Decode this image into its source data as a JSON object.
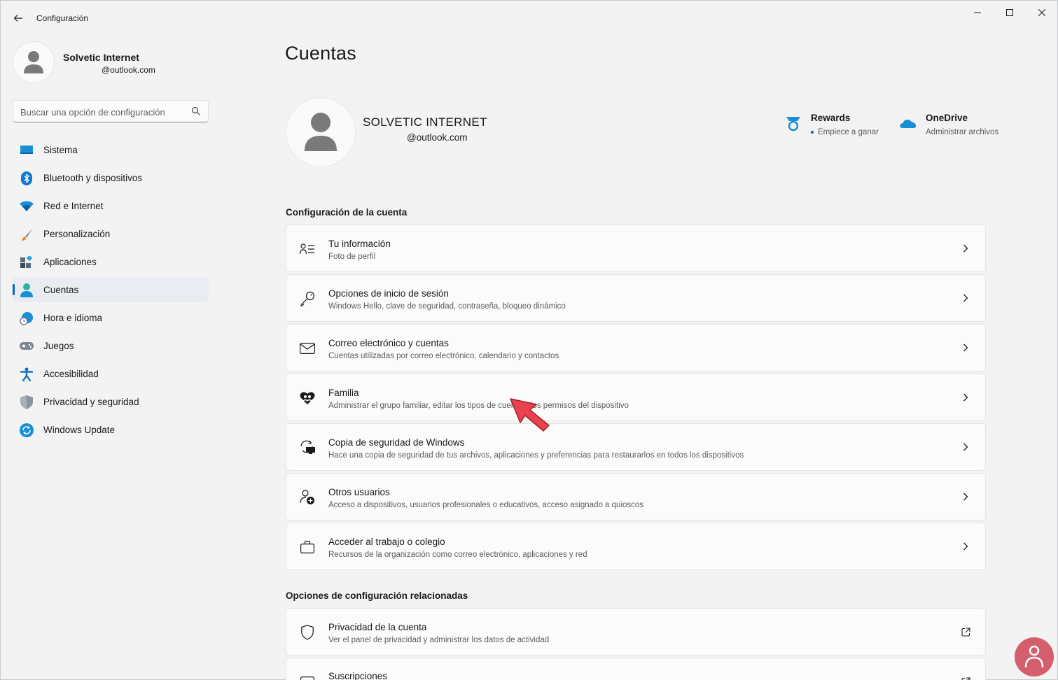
{
  "window": {
    "title": "Configuración"
  },
  "profile": {
    "name": "Solvetic Internet",
    "email": "@outlook.com"
  },
  "search": {
    "placeholder": "Buscar una opción de configuración"
  },
  "sidebar": {
    "items": [
      {
        "label": "Sistema",
        "icon": "monitor-icon",
        "active": false
      },
      {
        "label": "Bluetooth y dispositivos",
        "icon": "bluetooth-icon",
        "active": false
      },
      {
        "label": "Red e Internet",
        "icon": "wifi-icon",
        "active": false
      },
      {
        "label": "Personalización",
        "icon": "brush-icon",
        "active": false
      },
      {
        "label": "Aplicaciones",
        "icon": "apps-icon",
        "active": false
      },
      {
        "label": "Cuentas",
        "icon": "person-icon",
        "active": true
      },
      {
        "label": "Hora e idioma",
        "icon": "clock-globe-icon",
        "active": false
      },
      {
        "label": "Juegos",
        "icon": "gamepad-icon",
        "active": false
      },
      {
        "label": "Accesibilidad",
        "icon": "accessibility-icon",
        "active": false
      },
      {
        "label": "Privacidad y seguridad",
        "icon": "shield-icon",
        "active": false
      },
      {
        "label": "Windows Update",
        "icon": "update-icon",
        "active": false
      }
    ]
  },
  "main": {
    "title": "Cuentas",
    "account": {
      "name": "SOLVETIC INTERNET",
      "email": "@outlook.com"
    },
    "services": [
      {
        "title": "Rewards",
        "subtitle": "Empiece a ganar",
        "icon": "rewards-medal-icon"
      },
      {
        "title": "OneDrive",
        "subtitle": "Administrar archivos",
        "icon": "onedrive-cloud-icon"
      }
    ],
    "account_section_title": "Configuración de la cuenta",
    "account_cards": [
      {
        "title": "Tu información",
        "subtitle": "Foto de perfil",
        "icon": "person-card-icon"
      },
      {
        "title": "Opciones de inicio de sesión",
        "subtitle": "Windows Hello, clave de seguridad, contraseña, bloqueo dinámico",
        "icon": "key-icon"
      },
      {
        "title": "Correo electrónico y cuentas",
        "subtitle": "Cuentas utilizadas por correo electrónico, calendario y contactos",
        "icon": "mail-icon"
      },
      {
        "title": "Familia",
        "subtitle": "Administrar el grupo familiar, editar los tipos de cuenta y los permisos del dispositivo",
        "icon": "family-heart-icon"
      },
      {
        "title": "Copia de seguridad de Windows",
        "subtitle": "Hace una copia de seguridad de tus archivos, aplicaciones y preferencias para restaurarlos en todos los dispositivos",
        "icon": "backup-sync-icon"
      },
      {
        "title": "Otros usuarios",
        "subtitle": "Acceso a dispositivos, usuarios profesionales o educativos, acceso asignado a quioscos",
        "icon": "person-add-icon"
      },
      {
        "title": "Acceder al trabajo o colegio",
        "subtitle": "Recursos de la organización como correo electrónico, aplicaciones y red",
        "icon": "briefcase-icon"
      }
    ],
    "related_section_title": "Opciones de configuración relacionadas",
    "related_cards": [
      {
        "title": "Privacidad de la cuenta",
        "subtitle": "Ver el panel de privacidad y administrar los datos de actividad",
        "icon": "shield-outline-icon"
      },
      {
        "title": "Suscripciones",
        "subtitle": "",
        "icon": "subscription-card-icon"
      }
    ]
  },
  "colors": {
    "accent": "#0067c0",
    "pointer": "#e8414f"
  }
}
